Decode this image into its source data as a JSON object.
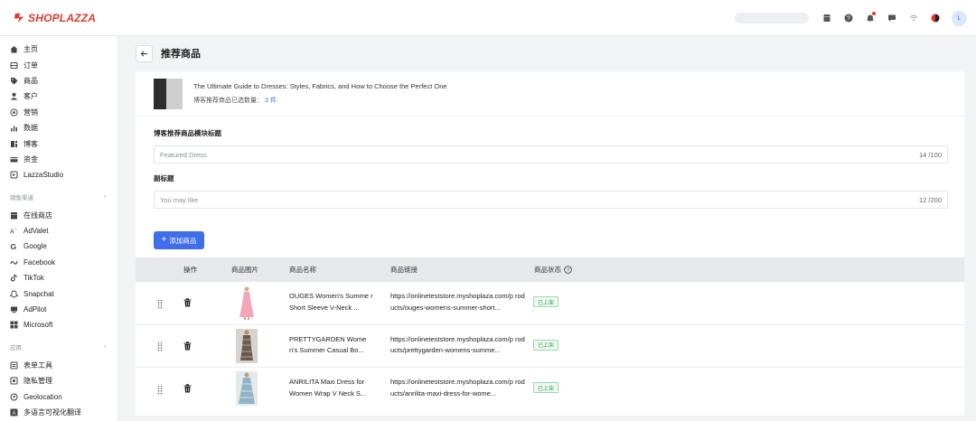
{
  "brand": {
    "name": "SHOPLAZZA",
    "color": "#e03a2f"
  },
  "topbar": {
    "icons": [
      "store-icon",
      "help-icon",
      "bell-icon",
      "message-icon",
      "wifi-icon",
      "theme-icon"
    ],
    "avatar": "L"
  },
  "sidebar": {
    "items": [
      {
        "label": "主页",
        "icon": "home-icon"
      },
      {
        "label": "订单",
        "icon": "orders-icon"
      },
      {
        "label": "商品",
        "icon": "tag-icon"
      },
      {
        "label": "客户",
        "icon": "person-icon"
      },
      {
        "label": "营销",
        "icon": "marketing-icon"
      },
      {
        "label": "数据",
        "icon": "chart-icon"
      },
      {
        "label": "博客",
        "icon": "blog-icon"
      },
      {
        "label": "资金",
        "icon": "finance-icon"
      },
      {
        "label": "LazzaStudio",
        "icon": "studio-icon"
      }
    ],
    "sales_section": "销售渠道",
    "channels": [
      {
        "label": "在线商店",
        "icon": "store-icon"
      },
      {
        "label": "AdValet",
        "icon": "advalet-icon"
      },
      {
        "label": "Google",
        "icon": "google-icon"
      },
      {
        "label": "Facebook",
        "icon": "facebook-icon"
      },
      {
        "label": "TikTok",
        "icon": "tiktok-icon"
      },
      {
        "label": "Snapchat",
        "icon": "snapchat-icon"
      },
      {
        "label": "AdPilot",
        "icon": "adpilot-icon"
      },
      {
        "label": "Microsoft",
        "icon": "microsoft-icon"
      }
    ],
    "apps_section": "应用",
    "apps": [
      {
        "label": "表单工具",
        "icon": "form-icon"
      },
      {
        "label": "隐私管理",
        "icon": "privacy-icon"
      },
      {
        "label": "Geolocation",
        "icon": "geolocation-icon"
      },
      {
        "label": "多语言可视化翻译",
        "icon": "translate-icon"
      }
    ]
  },
  "page": {
    "title": "推荐商品"
  },
  "blog": {
    "title": "The Ultimate Guide to Dresses: Styles, Fabrics, and How to Choose the Perfect One",
    "count_label": "博客推荐商品已选数量：",
    "count_value": "3 件"
  },
  "fields": {
    "module_title_label": "博客推荐商品模块标题",
    "module_title_value": "Featured Dress",
    "module_title_count": "14 /100",
    "subtitle_label": "副标题",
    "subtitle_value": "You may like",
    "subtitle_count": "12 /200"
  },
  "add_button": "添加商品",
  "table": {
    "headers": {
      "action": "操作",
      "image": "商品图片",
      "name": "商品名称",
      "link": "商品链接",
      "status": "商品状态"
    },
    "rows": [
      {
        "name": "OUGES Women's Summe r Short Sleeve V-Neck ...",
        "link": "https://onlineteststore.myshoplaza.com/p roducts/ouges-womens-summer-short...",
        "status": "已上架",
        "img_color": "#f2a7b8"
      },
      {
        "name": "PRETTYGARDEN Wome n's Summer Casual Bo...",
        "link": "https://onlineteststore.myshoplaza.com/p roducts/prettygarden-womens-summe...",
        "status": "已上架",
        "img_color": "#6b5a52"
      },
      {
        "name": "ANRILITA Maxi Dress for Women Wrap V Neck S...",
        "link": "https://onlineteststore.myshoplaza.com/p roducts/anrilita-maxi-dress-for-wome...",
        "status": "已上架",
        "img_color": "#8fb4c8"
      }
    ]
  }
}
